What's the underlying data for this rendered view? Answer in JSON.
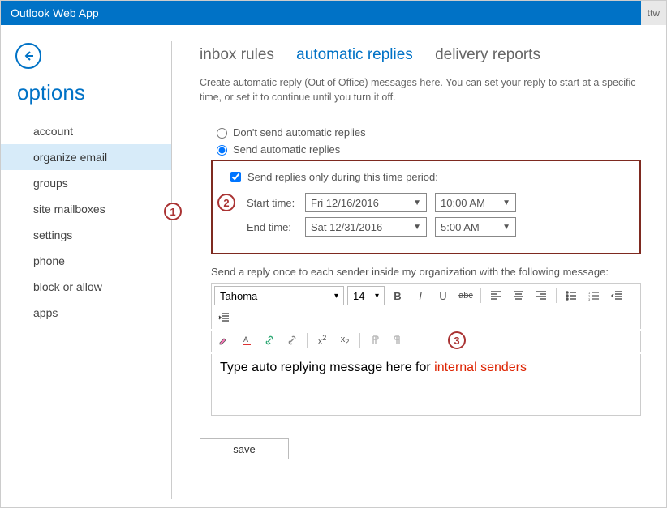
{
  "titlebar": {
    "app_name": "Outlook Web App",
    "right_tab": "ttw"
  },
  "options_header": "options",
  "sidebar": {
    "items": [
      {
        "label": "account"
      },
      {
        "label": "organize email"
      },
      {
        "label": "groups"
      },
      {
        "label": "site mailboxes"
      },
      {
        "label": "settings"
      },
      {
        "label": "phone"
      },
      {
        "label": "block or allow"
      },
      {
        "label": "apps"
      }
    ],
    "active_index": 1
  },
  "tabs": {
    "items": [
      {
        "label": "inbox rules"
      },
      {
        "label": "automatic replies"
      },
      {
        "label": "delivery reports"
      }
    ],
    "active_index": 1
  },
  "intro_text": "Create automatic reply (Out of Office) messages here. You can set your reply to start at a specific time, or set it to continue until you turn it off.",
  "radios": {
    "dont_send": "Don't send automatic replies",
    "send": "Send automatic replies"
  },
  "time_period": {
    "checkbox_label": "Send replies only during this time period:",
    "start_label": "Start time:",
    "end_label": "End time:",
    "start_date": "Fri 12/16/2016",
    "start_time": "10:00 AM",
    "end_date": "Sat 12/31/2016",
    "end_time": "5:00 AM"
  },
  "callouts": {
    "one": "1",
    "two": "2",
    "three": "3"
  },
  "reply_desc": "Send a reply once to each sender inside my organization with the following message:",
  "editor": {
    "font": "Tahoma",
    "size": "14",
    "body_prefix": "Type auto replying message here for ",
    "body_highlight": "internal senders"
  },
  "toolbar": {
    "bold": "B",
    "italic": "I",
    "underline": "U",
    "strike": "abc",
    "sup": "x",
    "sub": "x"
  },
  "save_label": "save"
}
